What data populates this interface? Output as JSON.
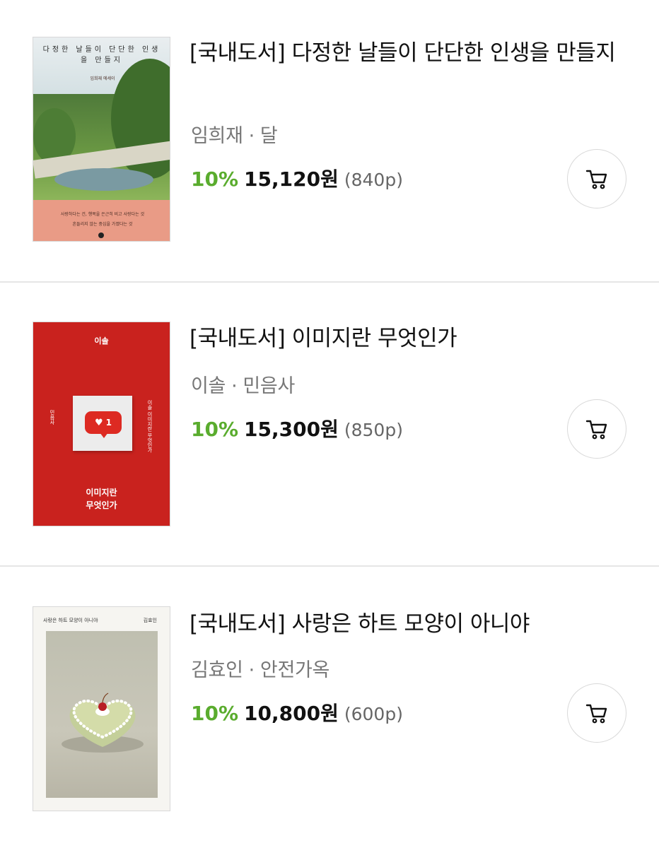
{
  "books": [
    {
      "title": "[국내도서] 다정한 날들이 단단한 인생을 만들지",
      "author": "임희재",
      "publisher": "달",
      "discount": "10%",
      "price": "15,120",
      "currency": "원",
      "points": "(840p)",
      "cover": {
        "title": "다정한 날들이 단단한 인생을 만들지",
        "author_line": "임희재 에세이",
        "tagline_1": "사랑하다는 건, 행복을 은근히 비고 사랑다는 것",
        "tagline_2": "흔들리지 않는 중심을 가졌다는 것"
      }
    },
    {
      "title": "[국내도서] 이미지란 무엇인가",
      "author": "이솔",
      "publisher": "민음사",
      "discount": "10%",
      "price": "15,300",
      "currency": "원",
      "points": "(850p)",
      "cover": {
        "brand": "이솔",
        "badge_count": "1",
        "title_line_1": "이미지란",
        "title_line_2": "무엇인가",
        "side_left": "민음사",
        "side_right": "이솔 이미지란 무엇인가"
      }
    },
    {
      "title": "[국내도서] 사랑은 하트 모양이 아니야",
      "author": "김효인",
      "publisher": "안전가옥",
      "discount": "10%",
      "price": "10,800",
      "currency": "원",
      "points": "(600p)",
      "cover": {
        "title": "사랑은 하트 모양이 아니야",
        "author": "김효인"
      }
    }
  ],
  "meta_separator": "·",
  "colors": {
    "discount": "#5aac2e",
    "divider": "#e6e6e6",
    "cover2_bg": "#c9221e"
  },
  "icons": {
    "cart": "cart-icon"
  }
}
